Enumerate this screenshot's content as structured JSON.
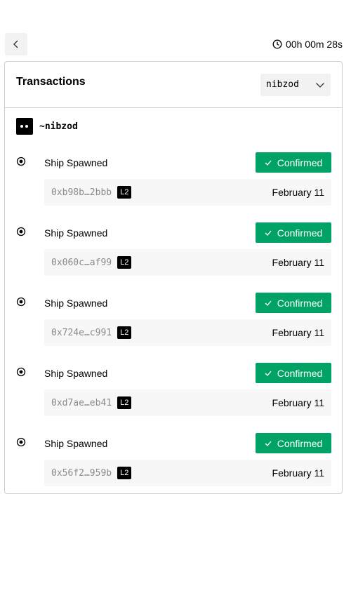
{
  "timer": {
    "text": "00h 00m 28s",
    "icon": "clock-icon"
  },
  "card": {
    "title": "Transactions"
  },
  "ship_select": {
    "value": "nibzod"
  },
  "ship": {
    "name": "~nibzod"
  },
  "transactions": [
    {
      "title": "Ship Spawned",
      "status": "Confirmed",
      "hash": "0xb98b…2bbb",
      "layer": "L2",
      "date": "February 11"
    },
    {
      "title": "Ship Spawned",
      "status": "Confirmed",
      "hash": "0x060c…af99",
      "layer": "L2",
      "date": "February 11"
    },
    {
      "title": "Ship Spawned",
      "status": "Confirmed",
      "hash": "0x724e…c991",
      "layer": "L2",
      "date": "February 11"
    },
    {
      "title": "Ship Spawned",
      "status": "Confirmed",
      "hash": "0xd7ae…eb41",
      "layer": "L2",
      "date": "February 11"
    },
    {
      "title": "Ship Spawned",
      "status": "Confirmed",
      "hash": "0x56f2…959b",
      "layer": "L2",
      "date": "February 11"
    }
  ],
  "colors": {
    "confirmed": "#00a265",
    "panel_bg": "#f7f7f7",
    "border": "#cfcfcf"
  }
}
